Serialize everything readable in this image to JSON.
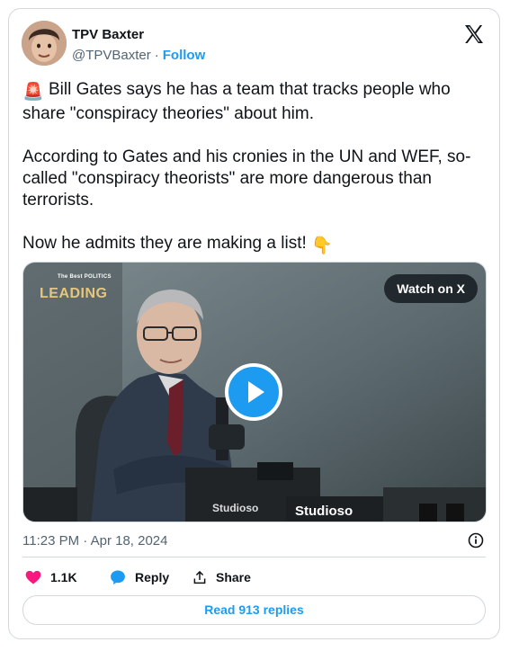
{
  "author": {
    "name": "TPV Baxter",
    "handle": "@TPVBaxter",
    "separator": "·",
    "follow_label": "Follow"
  },
  "tweet": {
    "emoji_start": "🚨",
    "line1": "Bill Gates says he has a team that tracks people who share \"conspiracy theories\" about him.",
    "line2": "According to Gates and his cronies in the UN and WEF, so-called \"conspiracy theorists\" are more dangerous than terrorists.",
    "line3": "Now he admits they are making a list!",
    "emoji_end": "👇"
  },
  "media": {
    "overlay_small": "The Best POLITICS",
    "overlay_brand": "LEADING",
    "watch_label": "Watch on X",
    "mic_label_left": "Studioso",
    "mic_label_right": "Studioso"
  },
  "meta": {
    "timestamp": "11:23 PM · Apr 18, 2024"
  },
  "actions": {
    "likes": "1.1K",
    "reply_label": "Reply",
    "share_label": "Share",
    "read_replies_label": "Read 913 replies"
  },
  "colors": {
    "accent": "#1d9bf0",
    "like": "#f91880",
    "secondary_text": "#536471",
    "border": "#cfd9de"
  },
  "icons": [
    "x-logo-icon",
    "play-icon",
    "info-icon",
    "heart-icon",
    "reply-bubble-icon",
    "share-upload-icon"
  ]
}
